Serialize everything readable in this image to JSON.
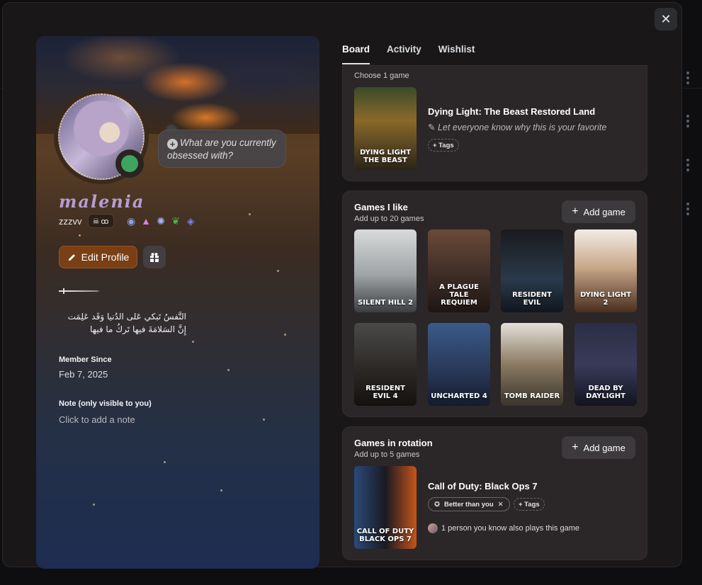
{
  "close": {
    "label": "✕"
  },
  "profile": {
    "thought_prompt": "What are you currently obsessed with?",
    "display_name": "malenia",
    "username": "zzzvv",
    "tag": "ꝏ",
    "edit_label": "Edit Profile",
    "bio_line1": "النَّفسُ تَبكي عَلى الدُنيا وَقَد عَلِمَت",
    "bio_line2": "إِنَّ السَلامَةَ فيها تَركُ ما فيها",
    "member_since_label": "Member Since",
    "member_since_value": "Feb 7, 2025",
    "note_label": "Note (only visible to you)",
    "note_placeholder": "Click to add a note",
    "status_color": "#3fa45f"
  },
  "tabs": [
    {
      "label": "Board",
      "active": true
    },
    {
      "label": "Activity",
      "active": false
    },
    {
      "label": "Wishlist",
      "active": false
    }
  ],
  "favorite": {
    "subtitle": "Choose 1 game",
    "game": "Dying Light: The Beast Restored Land",
    "cover_text": "DYING LIGHT THE BEAST",
    "why": "Let everyone know why this is your favorite",
    "tags_label": "+ Tags"
  },
  "liked": {
    "title": "Games I like",
    "subtitle": "Add up to 20 games",
    "add_label": "Add game",
    "games": [
      {
        "name": "SILENT HILL 2"
      },
      {
        "name": "A PLAGUE TALE REQUIEM"
      },
      {
        "name": "RESIDENT EVIL"
      },
      {
        "name": "DYING LIGHT 2"
      },
      {
        "name": "RESIDENT EVIL 4"
      },
      {
        "name": "UNCHARTED 4"
      },
      {
        "name": "TOMB RAIDER"
      },
      {
        "name": "DEAD BY DAYLIGHT"
      }
    ]
  },
  "rotation": {
    "title": "Games in rotation",
    "subtitle": "Add up to 5 games",
    "add_label": "Add game",
    "game": "Call of Duty: Black Ops 7",
    "cover_text": "CALL OF DUTY BLACK OPS 7",
    "rank_label": "Better than you",
    "tags_label": "+ Tags",
    "friends_text": "1 person you know also plays this game"
  }
}
